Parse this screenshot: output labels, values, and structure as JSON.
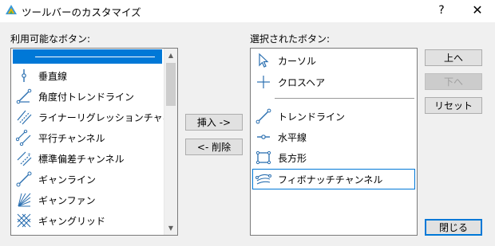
{
  "window": {
    "title": "ツールバーのカスタマイズ",
    "help": "?",
    "close": "✕"
  },
  "available": {
    "label": "利用可能なボタン:",
    "items": [
      {
        "label": "",
        "icon": "separator-icon"
      },
      {
        "label": "垂直線",
        "icon": "vertical-line-icon"
      },
      {
        "label": "角度付トレンドライン",
        "icon": "trendline-angle-icon"
      },
      {
        "label": "ライナーリグレッションチャネル",
        "icon": "regression-channel-icon"
      },
      {
        "label": "平行チャンネル",
        "icon": "parallel-channel-icon"
      },
      {
        "label": "標準偏差チャンネル",
        "icon": "stddev-channel-icon"
      },
      {
        "label": "ギャンライン",
        "icon": "gann-line-icon"
      },
      {
        "label": "ギャンファン",
        "icon": "gann-fan-icon"
      },
      {
        "label": "ギャングリッド",
        "icon": "gann-grid-icon"
      }
    ],
    "selected_index": 0
  },
  "selected": {
    "label": "選択されたボタン:",
    "items": [
      {
        "label": "カーソル",
        "icon": "cursor-icon"
      },
      {
        "label": "クロスヘア",
        "icon": "crosshair-icon"
      },
      {
        "label": "",
        "icon": "separator-icon"
      },
      {
        "label": "トレンドライン",
        "icon": "trendline-icon"
      },
      {
        "label": "水平線",
        "icon": "horizontal-line-icon"
      },
      {
        "label": "長方形",
        "icon": "rectangle-icon"
      },
      {
        "label": "フィボナッチチャンネル",
        "icon": "fibonacci-channel-icon"
      }
    ],
    "focused_index": 6
  },
  "buttons": {
    "insert": "挿入 ->",
    "remove": "<- 削除",
    "up": "上へ",
    "down": "下へ",
    "reset": "リセット",
    "close": "閉じる"
  },
  "colors": {
    "accent": "#0078d7",
    "icon": "#2a6fb0"
  }
}
